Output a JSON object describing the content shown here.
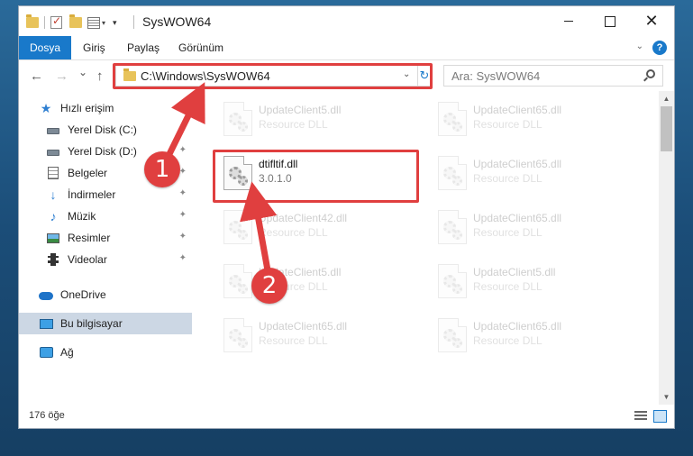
{
  "window": {
    "title": "SysWOW64",
    "min_glyph": "",
    "max_glyph": "",
    "close_glyph": "✕"
  },
  "ribbon": {
    "tabs": [
      {
        "label": "Dosya",
        "active": true
      },
      {
        "label": "Giriş"
      },
      {
        "label": "Paylaş"
      },
      {
        "label": "Görünüm"
      }
    ],
    "help": "?"
  },
  "address": {
    "back": "←",
    "forward": "→",
    "recent": "⌄",
    "up": "↑",
    "path": "C:\\Windows\\SysWOW64",
    "dropdown": "⌄",
    "refresh": "↻"
  },
  "search": {
    "placeholder": "Ara: SysWOW64"
  },
  "sidebar": {
    "items": [
      {
        "label": "Hızlı erişim",
        "icon": "star-icon"
      },
      {
        "label": "Yerel Disk (C:)",
        "icon": "drive-icon"
      },
      {
        "label": "Yerel Disk (D:)",
        "icon": "drive-icon",
        "pinned": true
      },
      {
        "label": "Belgeler",
        "icon": "documents-icon",
        "pinned": true
      },
      {
        "label": "İndirmeler",
        "icon": "download-icon",
        "pinned": true
      },
      {
        "label": "Müzik",
        "icon": "music-icon",
        "pinned": true
      },
      {
        "label": "Resimler",
        "icon": "pictures-icon",
        "pinned": true
      },
      {
        "label": "Videolar",
        "icon": "videos-icon",
        "pinned": true
      },
      {
        "label": "OneDrive",
        "icon": "onedrive-icon"
      },
      {
        "label": "Bu bilgisayar",
        "icon": "this-pc-icon",
        "selected": true
      },
      {
        "label": "Ağ",
        "icon": "network-icon"
      }
    ],
    "pin_glyph": "📌"
  },
  "files": [
    {
      "name": "UpdateClient5.dll",
      "sub": "Resource DLL",
      "faded": true
    },
    {
      "name": "UpdateClient65.dll",
      "sub": "Resource DLL",
      "faded": true
    },
    {
      "name": "dtifltif.dll",
      "sub": "3.0.1.0",
      "faded": false
    },
    {
      "name": "UpdateClient65.dll",
      "sub": "Resource DLL",
      "faded": true
    },
    {
      "name": "UpdateClient42.dll",
      "sub": "Resource DLL",
      "faded": true
    },
    {
      "name": "UpdateClient65.dll",
      "sub": "Resource DLL",
      "faded": true
    },
    {
      "name": "UpdateClient5.dll",
      "sub": "Resource DLL",
      "faded": true
    },
    {
      "name": "UpdateClient5.dll",
      "sub": "Resource DLL",
      "faded": true
    },
    {
      "name": "UpdateClient65.dll",
      "sub": "Resource DLL",
      "faded": true
    },
    {
      "name": "UpdateClient65.dll",
      "sub": "Resource DLL",
      "faded": true
    }
  ],
  "scroll": {
    "up": "▲",
    "down": "▼"
  },
  "status": {
    "item_count": "176 öğe"
  },
  "annotations": {
    "step1": "1",
    "step2": "2",
    "color": "#e03f3f"
  }
}
